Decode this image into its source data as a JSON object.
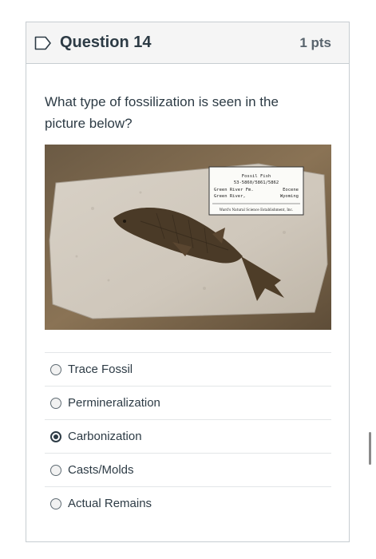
{
  "question": {
    "title": "Question 14",
    "points": "1 pts",
    "prompt": "What type of fossilization is seen in the picture below?"
  },
  "image": {
    "label_lines": [
      "Fossil Fish",
      "53-5860/5861/5862",
      "Green River Fm.",
      "Eocene",
      "Green River,",
      "Wyoming",
      "Ward's Natural Science Establishment, Inc."
    ]
  },
  "answers": [
    {
      "label": "Trace Fossil",
      "selected": false
    },
    {
      "label": "Permineralization",
      "selected": false
    },
    {
      "label": "Carbonization",
      "selected": true
    },
    {
      "label": "Casts/Molds",
      "selected": false
    },
    {
      "label": "Actual Remains",
      "selected": false
    }
  ],
  "colors": {
    "text": "#2d3b45",
    "border": "#c7cdd1",
    "header_bg": "#f5f5f5"
  },
  "icons": {
    "flag": "bookmark-flag-icon"
  }
}
